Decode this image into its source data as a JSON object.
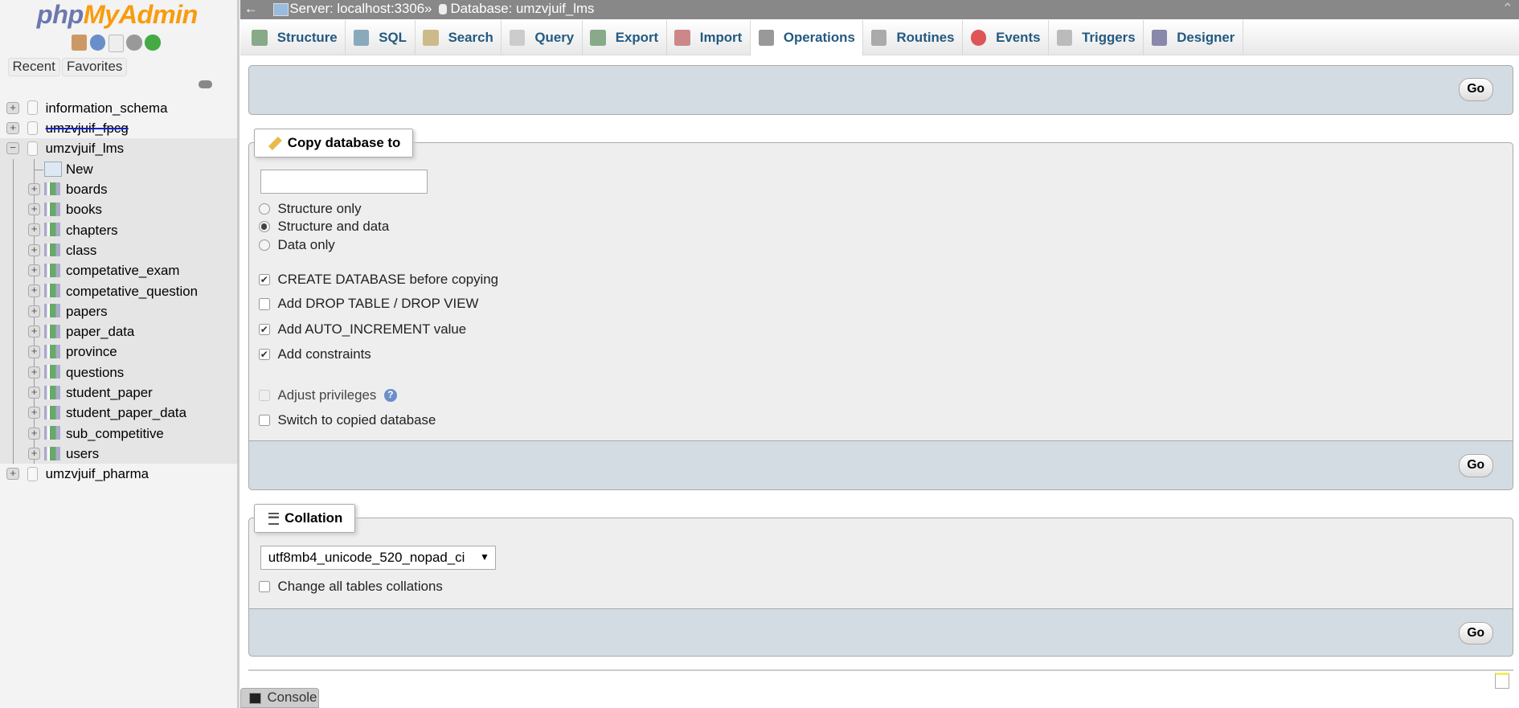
{
  "logo": {
    "php": "php",
    "myadmin": "MyAdmin"
  },
  "sidebar": {
    "recent": "Recent",
    "favorites": "Favorites",
    "databases": [
      {
        "name": "information_schema",
        "expanded": false
      },
      {
        "name": "umzvjuif_fpcg",
        "expanded": false,
        "scribbled": true
      },
      {
        "name": "umzvjuif_lms",
        "expanded": true,
        "tables": [
          "New",
          "boards",
          "books",
          "chapters",
          "class",
          "competative_exam",
          "competative_question",
          "papers",
          "paper_data",
          "province",
          "questions",
          "student_paper",
          "student_paper_data",
          "sub_competitive",
          "users"
        ]
      },
      {
        "name": "umzvjuif_pharma",
        "expanded": false
      }
    ]
  },
  "topbar": {
    "back": "←",
    "server": "Server: localhost:3306",
    "sep": "»",
    "database": "Database: umzvjuif_lms",
    "collapse": "⌃"
  },
  "tabs": [
    {
      "label": "Structure",
      "icon": "structure-icon"
    },
    {
      "label": "SQL",
      "icon": "sql-icon"
    },
    {
      "label": "Search",
      "icon": "search-icon"
    },
    {
      "label": "Query",
      "icon": "query-icon"
    },
    {
      "label": "Export",
      "icon": "export-icon"
    },
    {
      "label": "Import",
      "icon": "import-icon"
    },
    {
      "label": "Operations",
      "icon": "wrench-icon",
      "active": true
    },
    {
      "label": "Routines",
      "icon": "routines-icon"
    },
    {
      "label": "Events",
      "icon": "clock-icon"
    },
    {
      "label": "Triggers",
      "icon": "triggers-icon"
    },
    {
      "label": "Designer",
      "icon": "designer-icon"
    }
  ],
  "go": "Go",
  "copy": {
    "legend": "Copy database to",
    "input_value": "",
    "radios": [
      {
        "label": "Structure only",
        "checked": false
      },
      {
        "label": "Structure and data",
        "checked": true
      },
      {
        "label": "Data only",
        "checked": false
      }
    ],
    "checks": [
      {
        "label": "CREATE DATABASE before copying",
        "checked": true
      },
      {
        "label": "Add DROP TABLE / DROP VIEW",
        "checked": false
      },
      {
        "label": "Add AUTO_INCREMENT value",
        "checked": true
      },
      {
        "label": "Add constraints",
        "checked": true
      },
      {
        "label": "Adjust privileges",
        "checked": false,
        "disabled": true
      },
      {
        "label": "Switch to copied database",
        "checked": false
      }
    ]
  },
  "collation": {
    "legend": "Collation",
    "selected": "utf8mb4_unicode_520_nopad_ci",
    "change_all": "Change all tables collations"
  },
  "console": "Console",
  "colors": {
    "tab_text": "#235a81",
    "footer_bg": "#d3dce3",
    "topbar_bg": "#888888"
  }
}
